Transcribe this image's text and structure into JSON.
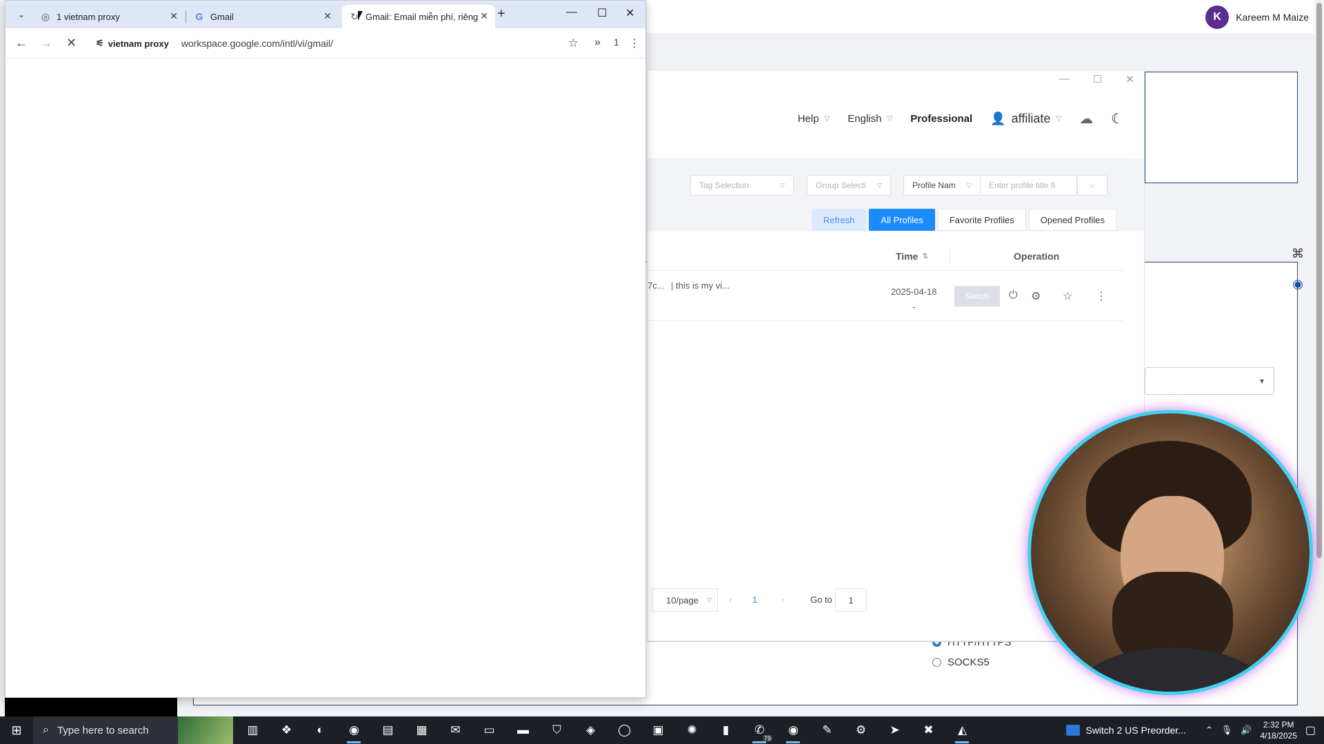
{
  "background_page": {
    "user_initial": "K",
    "user_name": "Kareem M Maize",
    "radio_options": [
      "HTTP/HTTPS",
      "SOCKS5"
    ]
  },
  "app_window": {
    "header": {
      "help": "Help",
      "language": "English",
      "plan": "Professional",
      "account": "affiliate"
    },
    "filters": {
      "tag_placeholder": "Tag Selection",
      "group_placeholder": "Group Selecti",
      "profile_name_select": "Profile Nam",
      "search_placeholder": "Enter profile title fi"
    },
    "tabs": {
      "refresh": "Refresh",
      "all": "All Profiles",
      "favorite": "Favorite Profiles",
      "opened": "Opened Profiles"
    },
    "table": {
      "col_time": "Time",
      "col_operation": "Operation",
      "rows": [
        {
          "name_fragment": "7c...",
          "note": "| this is my vi...",
          "date": "2025-04-18",
          "date_sub": "-",
          "switch_label": "Switch"
        }
      ]
    },
    "pager": {
      "page_size": "10/page",
      "current_page": "1",
      "goto_label": "Go to",
      "goto_value": "1"
    }
  },
  "browser": {
    "tabs": [
      {
        "title": "1 vietnam proxy",
        "active": false
      },
      {
        "title": "Gmail",
        "active": false
      },
      {
        "title": "Gmail: Email miễn phí, riêng",
        "active": true
      }
    ],
    "proxy_chip": "vietnam proxy",
    "url": "workspace.google.com/intl/vi/gmail/",
    "extensions_count": "1"
  },
  "taskbar": {
    "search_placeholder": "Type here to search",
    "whatsapp_badge": "79",
    "news_text": "Switch 2 US Preorder...",
    "time": "2:32 PM",
    "date": "4/18/2025"
  },
  "colors": {
    "primary_blue": "#1a8cff",
    "tabbar": "#dfe6f5",
    "taskbar": "#1c1f26"
  }
}
